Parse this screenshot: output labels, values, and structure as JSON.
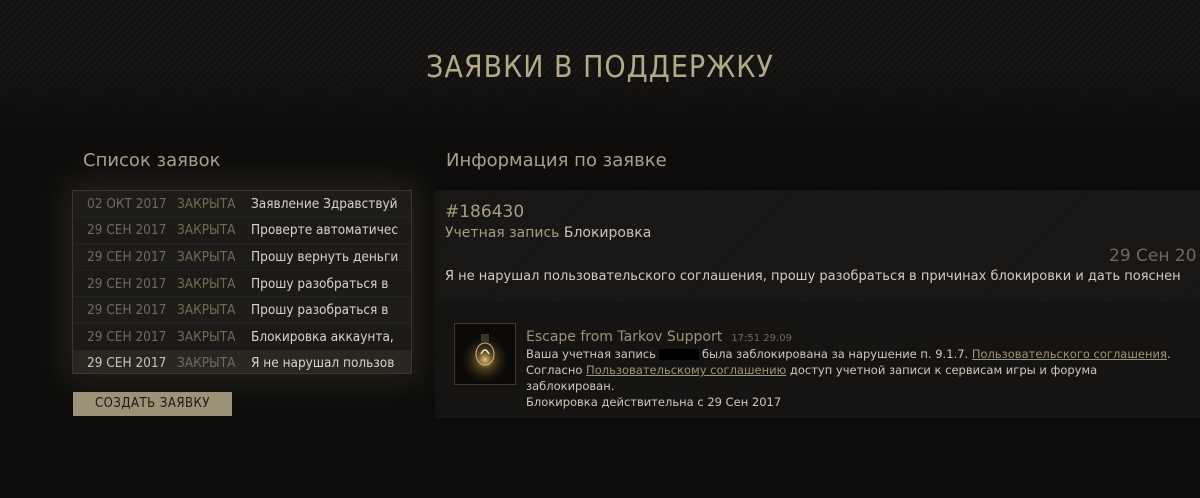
{
  "page": {
    "title": "ЗАЯВКИ В ПОДДЕРЖКУ"
  },
  "list": {
    "heading": "Список заявок",
    "rows": [
      {
        "date": "02 ОКТ 2017",
        "status": "ЗАКРЫТА",
        "subject": "Заявление Здравствуй"
      },
      {
        "date": "29 СЕН 2017",
        "status": "ЗАКРЫТА",
        "subject": "Проверте автоматичес"
      },
      {
        "date": "29 СЕН 2017",
        "status": "ЗАКРЫТА",
        "subject": "Прошу вернуть деньги"
      },
      {
        "date": "29 СЕН 2017",
        "status": "ЗАКРЫТА",
        "subject": "Прошу разобраться в"
      },
      {
        "date": "29 СЕН 2017",
        "status": "ЗАКРЫТА",
        "subject": "Прошу разобраться в"
      },
      {
        "date": "29 СЕН 2017",
        "status": "ЗАКРЫТА",
        "subject": "Блокировка аккаунта,"
      },
      {
        "date": "29 СЕН 2017",
        "status": "ЗАКРЫТА",
        "subject": "Я не нарушал пользов"
      }
    ],
    "create_button": "СОЗДАТЬ ЗАЯВКУ"
  },
  "info": {
    "heading": "Информация по заявке",
    "ticket_id": "#186430",
    "category": "Учетная запись",
    "subcategory": "Блокировка",
    "date": "29 Сен 20",
    "body": "Я не нарушал пользовательского соглашения, прошу разобраться в причинах блокировки и дать пояснен",
    "reply": {
      "author": "Escape from Tarkov Support",
      "time": "17:51 29.09",
      "line1_a": "Ваша учетная запись",
      "line1_b": "была заблокирована за нарушение п. 9.1.7.",
      "line1_link": "Пользовательского соглашения",
      "line1_end": ".",
      "line2_a": "Согласно",
      "line2_link": "Пользовательскому соглашению",
      "line2_b": "доступ учетной записи к сервисам игры и форума заблокирован.",
      "line3": "Блокировка действительна с 29 Сен 2017"
    }
  },
  "colors": {
    "accent": "#b3a98a",
    "button": "#9b9278",
    "background": "#0d0c0b"
  }
}
